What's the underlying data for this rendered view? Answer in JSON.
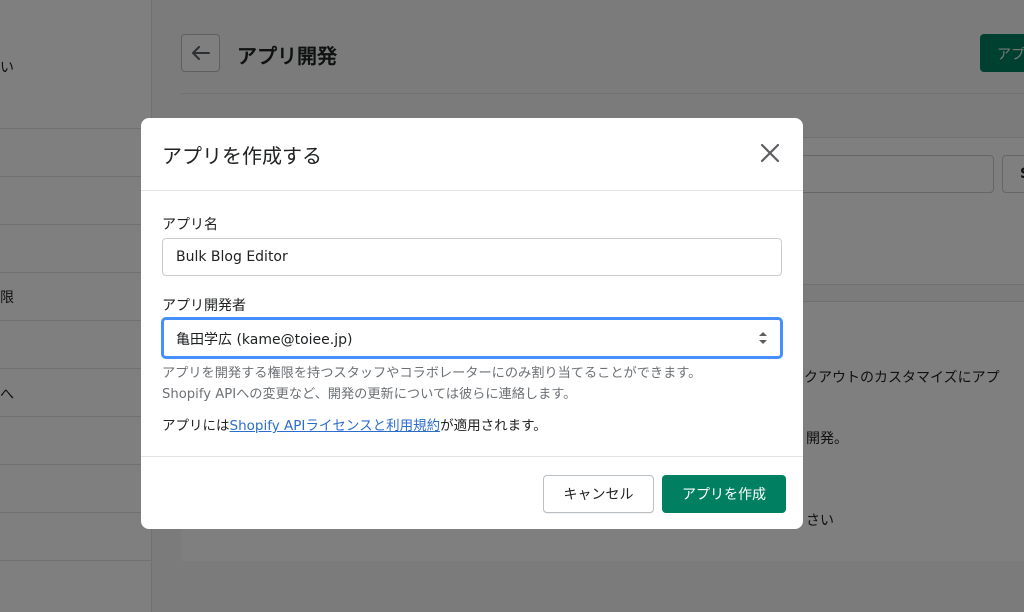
{
  "background": {
    "sidebar_fragments": [
      "い",
      "限",
      "へ"
    ],
    "page_title": "アプリ開発",
    "primary_button_fragment": "アプ",
    "search_button_fragment": "S",
    "content_fragments": [
      "ックアウトのカスタマイズにアプ",
      "開発。",
      "さい"
    ]
  },
  "modal": {
    "title": "アプリを作成する",
    "app_name_label": "アプリ名",
    "app_name_value": "Bulk Blog Editor",
    "developer_label": "アプリ開発者",
    "developer_value": "亀田学広 (kame@toiee.jp)",
    "help_line_1": "アプリを開発する権限を持つスタッフやコラボレーターにのみ割り当てることができます。",
    "help_line_2": "Shopify APIへの変更など、開発の更新については彼らに連絡します。",
    "license_prefix": "アプリには",
    "license_link": "Shopify APIライセンスと利用規約",
    "license_suffix": "が適用されます。",
    "cancel_label": "キャンセル",
    "create_label": "アプリを作成"
  },
  "colors": {
    "primary": "#008060",
    "link": "#2c6ecb",
    "focus": "#458fff"
  }
}
